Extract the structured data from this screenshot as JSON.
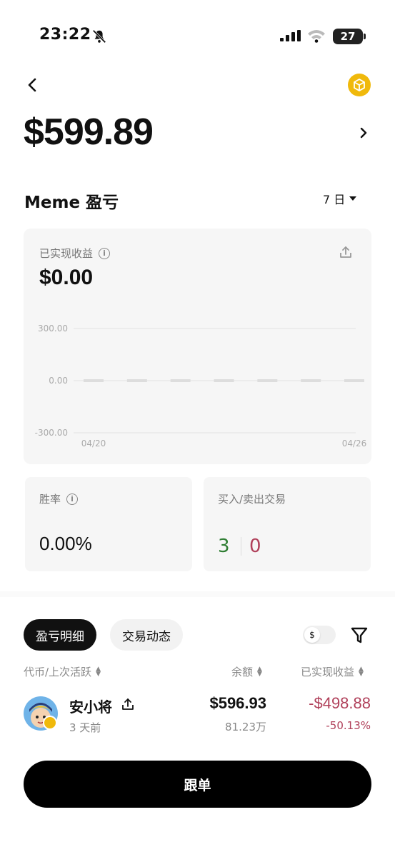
{
  "status_bar": {
    "time": "23:22",
    "battery": "27"
  },
  "header": {
    "balance": "$599.89"
  },
  "pnl": {
    "title": "Meme 盈亏",
    "range": "7 日",
    "realized_label": "已实现收益",
    "realized_value": "$0.00"
  },
  "chart_data": {
    "type": "bar",
    "categories": [
      "04/20",
      "04/21",
      "04/22",
      "04/23",
      "04/24",
      "04/25",
      "04/26"
    ],
    "values": [
      0,
      0,
      0,
      0,
      0,
      0,
      0
    ],
    "ylim": [
      -300,
      300
    ],
    "y_ticks": [
      "300.00",
      "0.00",
      "-300.00"
    ],
    "x_tick_labels": [
      "04/20",
      "04/26"
    ],
    "grid": true
  },
  "stats": {
    "win_rate_label": "胜率",
    "win_rate_value": "0.00%",
    "trades_label": "买入/卖出交易",
    "buy_count": "3",
    "sell_count": "0",
    "buy_color": "#2e7d32",
    "sell_color": "#b0405a"
  },
  "tabs": {
    "active": "盈亏明细",
    "inactive": "交易动态"
  },
  "currency_toggle": "$",
  "columns": {
    "token": "代币/上次活跃",
    "balance": "余额",
    "realized": "已实现收益"
  },
  "rows": [
    {
      "name": "安小将",
      "last_active": "3 天前",
      "balance_usd": "$596.93",
      "balance_amount": "81.23万",
      "pnl_usd": "-$498.88",
      "pnl_pct": "-50.13%"
    }
  ],
  "follow_button": "跟单",
  "colors": {
    "accent_gold": "#f0b90b",
    "loss": "#b0405a",
    "gain": "#2e7d32"
  }
}
